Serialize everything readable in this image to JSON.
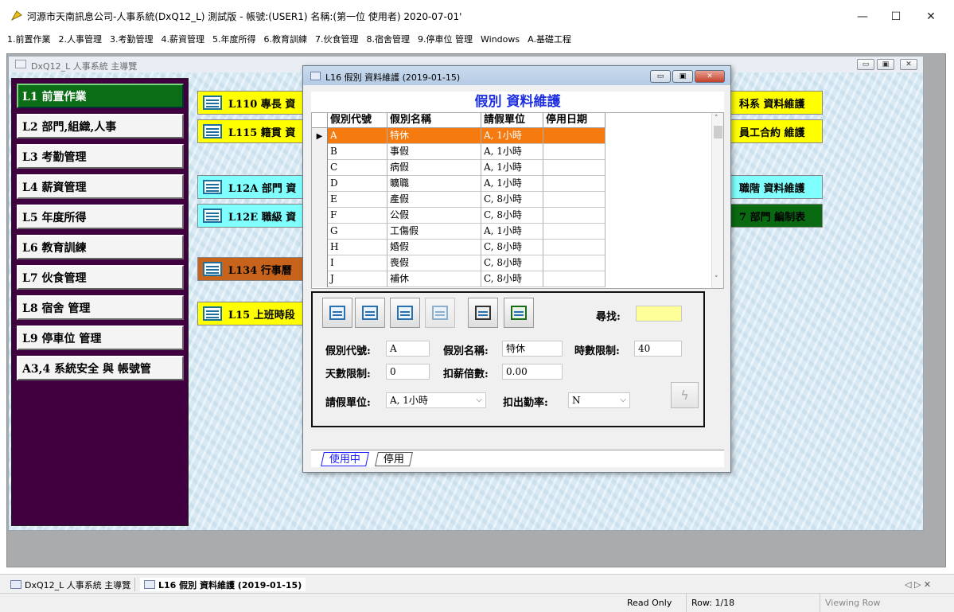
{
  "window": {
    "title": "河源市天南訊息公司-人事系統(DxQ12_L) 測試版 - 帳號:(USER1) 名稱:(第一位 使用者) 2020-07-01'",
    "minimize": "—",
    "maximize": "☐",
    "close": "✕"
  },
  "menu": [
    "1.前置作業",
    "2.人事管理",
    "3.考勤管理",
    "4.薪資管理",
    "5.年度所得",
    "6.教育訓練",
    "7.伙食管理",
    "8.宿舍管理",
    "9.停車位 管理",
    "Windows",
    "A.基礎工程"
  ],
  "main_window": {
    "title": "DxQ12_L 人事系統 主導覽"
  },
  "sidebar": [
    {
      "label": "L1 前置作業",
      "active": true
    },
    {
      "label": "L2 部門,組織,人事"
    },
    {
      "label": "L3 考勤管理"
    },
    {
      "label": "L4 薪資管理"
    },
    {
      "label": "L5 年度所得"
    },
    {
      "label": "L6 教育訓練"
    },
    {
      "label": "L7 伙食管理"
    },
    {
      "label": "L8 宿舍 管理"
    },
    {
      "label": "L9 停車位 管理"
    },
    {
      "label": "A3,4 系統安全 與 帳號管"
    }
  ],
  "programs_left": [
    {
      "label": "L110 專長 資",
      "color": "yellow"
    },
    {
      "label": "L115 籍貫 資",
      "color": "yellow"
    },
    {
      "label": "L12A 部門 資",
      "color": "cyan"
    },
    {
      "label": "L12E 職級 資",
      "color": "cyan"
    },
    {
      "label": "L134 行事曆",
      "color": "orange"
    },
    {
      "label": "L15 上班時段",
      "color": "yellow"
    }
  ],
  "programs_right": [
    {
      "label": "科系 資料維護",
      "color": "yellow"
    },
    {
      "label": "員工合約 維護",
      "color": "yellow"
    },
    {
      "label": "職階 資料維護",
      "color": "cyan"
    },
    {
      "label": "7 部門 編制表",
      "color": "green"
    }
  ],
  "dialog": {
    "title": "L16 假別 資料維護 (2019-01-15)",
    "heading": "假別 資料維護",
    "columns": [
      "假別代號",
      "假別名稱",
      "請假單位",
      "停用日期"
    ],
    "rows": [
      [
        "A",
        "特休",
        "A, 1小時",
        ""
      ],
      [
        "B",
        "事假",
        "A, 1小時",
        ""
      ],
      [
        "C",
        "病假",
        "A, 1小時",
        ""
      ],
      [
        "D",
        "曠職",
        "A, 1小時",
        ""
      ],
      [
        "E",
        "產假",
        "C, 8小時",
        ""
      ],
      [
        "F",
        "公假",
        "C, 8小時",
        ""
      ],
      [
        "G",
        "工傷假",
        "A, 1小時",
        ""
      ],
      [
        "H",
        "婚假",
        "C, 8小時",
        ""
      ],
      [
        "I",
        "喪假",
        "C, 8小時",
        ""
      ],
      [
        "J",
        "補休",
        "C, 8小時",
        ""
      ]
    ],
    "selected_marker": "▶",
    "search_label": "尋找:",
    "search_value": "",
    "form": {
      "code_label": "假別代號:",
      "code_value": "A",
      "name_label": "假別名稱:",
      "name_value": "特休",
      "hours_label": "時數限制:",
      "hours_value": "40",
      "days_label": "天數限制:",
      "days_value": "0",
      "pay_label": "扣薪倍數:",
      "pay_value": "0.00",
      "unit_label": "請假單位:",
      "unit_value": "A, 1小時",
      "attendance_label": "扣出勤率:",
      "attendance_value": "N"
    },
    "tabs": [
      "使用中",
      "停用"
    ]
  },
  "taskbar": [
    "DxQ12_L 人事系統 主導覽",
    "L16 假別 資料維護 (2019-01-15)"
  ],
  "taskbar_arrows": "◁ ▷ ✕",
  "status": {
    "mode": "Read Only",
    "row": "Row: 1/18",
    "view": "Viewing Row"
  }
}
